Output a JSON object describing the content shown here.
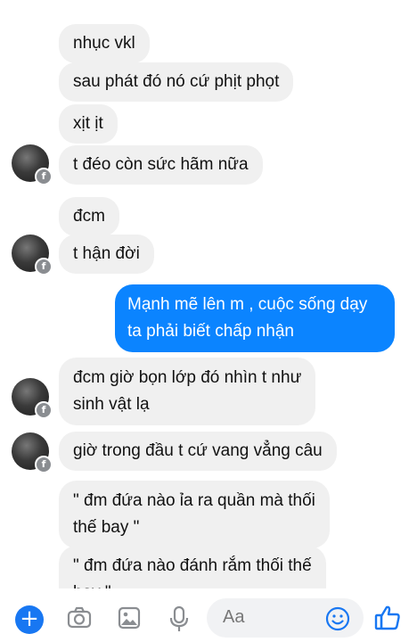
{
  "messages": [
    {
      "text": "nhục vkl",
      "direction": "incoming"
    },
    {
      "text": "sau phát đó nó cứ phịt phọt",
      "direction": "incoming"
    },
    {
      "text": "xịt ịt",
      "direction": "incoming"
    },
    {
      "text": "t đéo còn sức hãm nữa",
      "direction": "incoming"
    },
    {
      "text": "đcm",
      "direction": "incoming"
    },
    {
      "text": "t hận đời",
      "direction": "incoming"
    },
    {
      "line1": "Mạnh mẽ lên m , cuộc sống dạy",
      "line2": "ta phải biết chấp nhận",
      "direction": "outgoing"
    },
    {
      "line1": "đcm giờ bọn lớp đó nhìn t như",
      "line2": "sinh vật lạ",
      "direction": "incoming"
    },
    {
      "text": "giờ trong đầu t cứ vang vẳng câu",
      "direction": "incoming"
    },
    {
      "line1": "\" đm đứa nào ỉa ra quần mà thối",
      "line2": "thế bay \"",
      "direction": "incoming"
    },
    {
      "line1": "\" đm đứa nào đánh rắm thối thế",
      "line2": "bay \"",
      "direction": "incoming"
    }
  ],
  "composer": {
    "placeholder": "Aa",
    "icons": [
      "plus-icon",
      "camera-icon",
      "image-icon",
      "microphone-icon",
      "emoji-icon",
      "like-thumb-icon"
    ]
  },
  "colors": {
    "incoming_bubble": "#f0f0f0",
    "outgoing_bubble": "#0b84ff",
    "accent": "#1877f2"
  }
}
